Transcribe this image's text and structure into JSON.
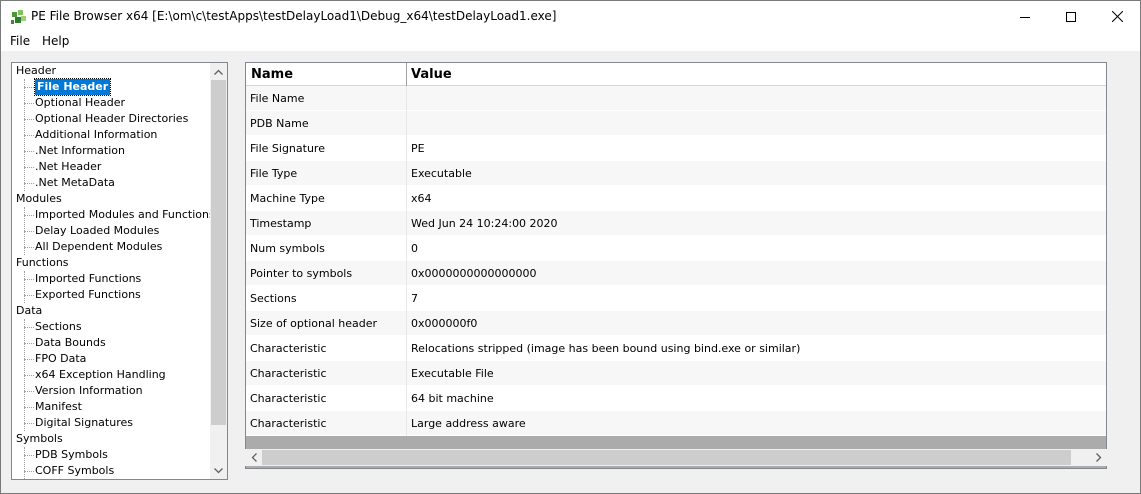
{
  "window": {
    "title": "PE File Browser x64 [E:\\om\\c\\testApps\\testDelayLoad1\\Debug_x64\\testDelayLoad1.exe]",
    "icon": "pe-browser-app-icon"
  },
  "menu": {
    "file": "File",
    "help": "Help"
  },
  "tree": {
    "groups": [
      {
        "label": "Header",
        "children": [
          "File Header",
          "Optional Header",
          "Optional Header Directories",
          "Additional Information",
          ".Net Information",
          ".Net Header",
          ".Net MetaData"
        ]
      },
      {
        "label": "Modules",
        "children": [
          "Imported Modules and Functions",
          "Delay Loaded Modules",
          "All Dependent Modules"
        ]
      },
      {
        "label": "Functions",
        "children": [
          "Imported Functions",
          "Exported Functions"
        ]
      },
      {
        "label": "Data",
        "children": [
          "Sections",
          "Data Bounds",
          "FPO Data",
          "x64 Exception Handling",
          "Version Information",
          "Manifest",
          "Digital Signatures"
        ]
      },
      {
        "label": "Symbols",
        "children": [
          "PDB Symbols",
          "COFF Symbols"
        ]
      }
    ],
    "selected": "File Header"
  },
  "grid": {
    "columns": [
      "Name",
      "Value"
    ],
    "rows": [
      {
        "name": "File Name",
        "value": ""
      },
      {
        "name": "PDB Name",
        "value": ""
      },
      {
        "name": "File Signature",
        "value": "PE"
      },
      {
        "name": "File Type",
        "value": "Executable"
      },
      {
        "name": "Machine Type",
        "value": "x64"
      },
      {
        "name": "Timestamp",
        "value": "Wed Jun 24 10:24:00 2020"
      },
      {
        "name": "Num symbols",
        "value": "0"
      },
      {
        "name": "Pointer to symbols",
        "value": "0x0000000000000000"
      },
      {
        "name": "Sections",
        "value": "7"
      },
      {
        "name": "Size of optional header",
        "value": "0x000000f0"
      },
      {
        "name": "Characteristic",
        "value": "Relocations stripped (image has been bound using bind.exe or similar)"
      },
      {
        "name": "Characteristic",
        "value": "Executable File"
      },
      {
        "name": "Characteristic",
        "value": "64 bit machine"
      },
      {
        "name": "Characteristic",
        "value": "Large address aware"
      }
    ]
  },
  "colors": {
    "selection": "#0078d7",
    "scroll_thumb": "#cdcdcd",
    "grid_empty_area": "#ababab"
  }
}
